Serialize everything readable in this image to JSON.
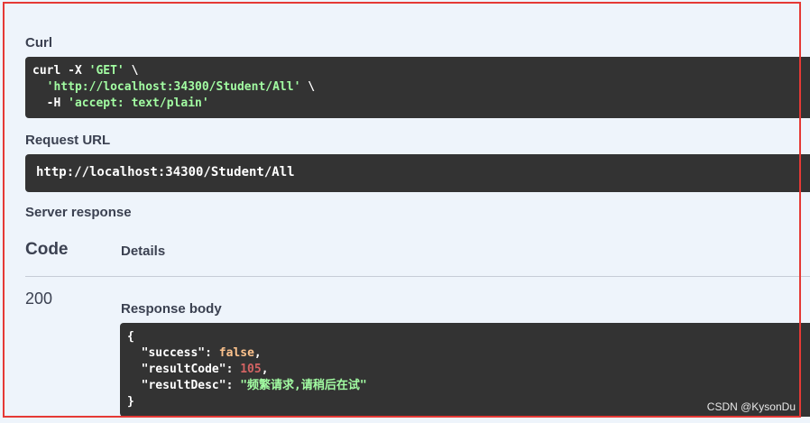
{
  "curl": {
    "title": "Curl",
    "line1_cmd": "curl -X ",
    "line1_method": "'GET'",
    "line1_cont": " \\",
    "line2_indent": "  ",
    "line2_url": "'http://localhost:34300/Student/All'",
    "line2_cont": " \\",
    "line3_flag": "  -H ",
    "line3_header": "'accept: text/plain'"
  },
  "request_url": {
    "title": "Request URL",
    "value": "http://localhost:34300/Student/All"
  },
  "server_response": {
    "title": "Server response",
    "code_header": "Code",
    "details_header": "Details",
    "status_code": "200",
    "response_body_title": "Response body",
    "body": {
      "open_brace": "{",
      "success_key": "\"success\"",
      "success_value": "false",
      "resultCode_key": "\"resultCode\"",
      "resultCode_value": "105",
      "resultDesc_key": "\"resultDesc\"",
      "resultDesc_value": "\"频繁请求,请稍后在试\"",
      "close_brace": "}"
    }
  },
  "watermark": "CSDN @KysonDu",
  "colors": {
    "panel_bg": "#eef4fb",
    "code_bg": "#333333",
    "string": "#a2fca2",
    "number": "#d36363",
    "boolean": "#fcc28c",
    "highlight_border": "#e53935"
  }
}
